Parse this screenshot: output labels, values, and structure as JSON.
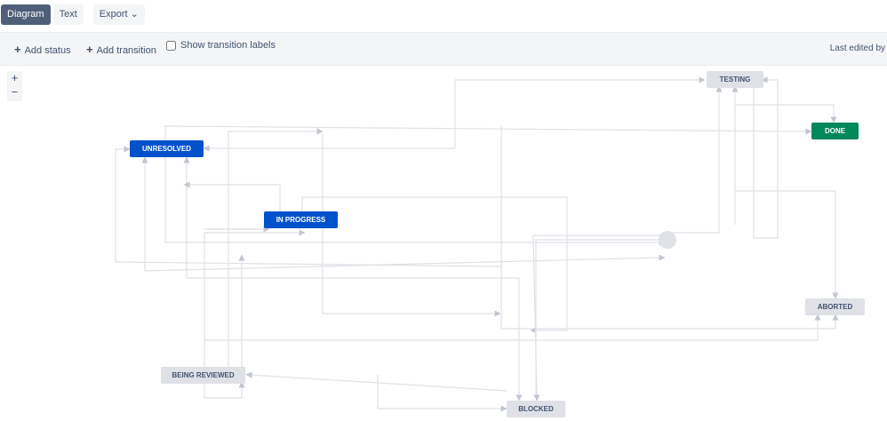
{
  "tabs": {
    "diagram": "Diagram",
    "text": "Text",
    "export": "Export ⌄"
  },
  "toolbar": {
    "add_status": "Add status",
    "add_transition": "Add transition",
    "show_labels": "Show transition labels",
    "last_edited": "Last edited by"
  },
  "zoom": {
    "in": "+",
    "out": "−"
  },
  "nodes": {
    "testing": "TESTING",
    "done": "DONE",
    "unresolved": "UNRESOLVED",
    "in_progress": "IN PROGRESS",
    "aborted": "ABORTED",
    "being_reviewed": "BEING REVIEWED",
    "blocked": "BLOCKED"
  },
  "colors": {
    "status_blue": "#0052cc",
    "status_green": "#00875a",
    "status_gray": "#dfe1e6"
  }
}
